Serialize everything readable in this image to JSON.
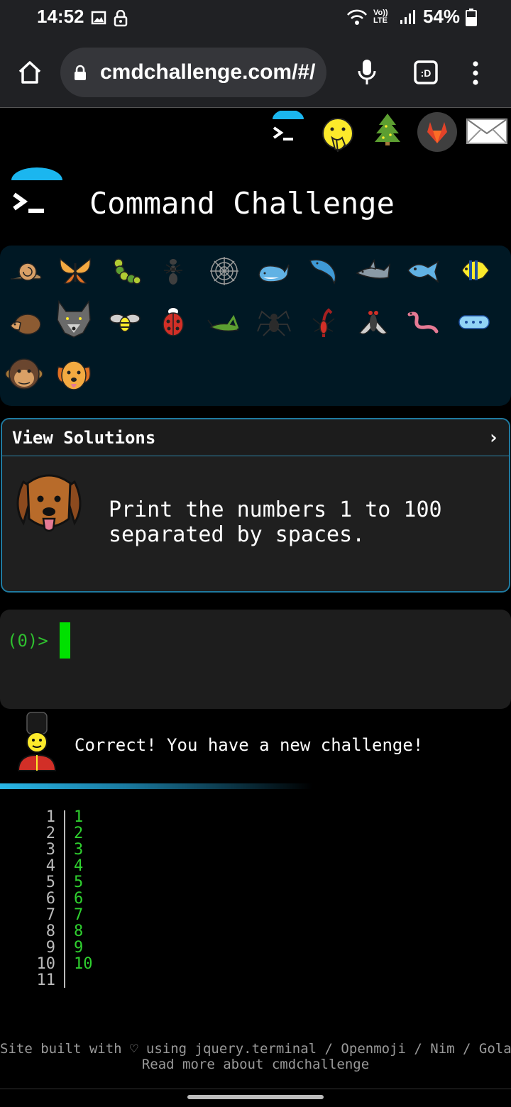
{
  "status_bar": {
    "time": "14:52",
    "battery_pct": "54%",
    "network": "Vo)) LTE",
    "icons": [
      "gallery-icon",
      "lock-icon",
      "wifi-icon",
      "signal-icon",
      "battery-icon"
    ]
  },
  "browser": {
    "url": "cmdchallenge.com/#/",
    "icons": [
      "home-icon",
      "lock-icon",
      "mic-icon",
      "tab-switcher-icon",
      "kebab-menu-icon"
    ]
  },
  "top_icons": [
    "terminal-logo-icon",
    "shushing-face-icon",
    "tree-icon",
    "gitlab-icon",
    "mail-icon"
  ],
  "title": "Command Challenge",
  "challenges": [
    "snail",
    "butterfly",
    "caterpillar",
    "ant",
    "spiderweb",
    "whale",
    "dolphin",
    "shark",
    "fish",
    "tropical-fish",
    "hedgehog",
    "wolf",
    "bee",
    "ladybug",
    "cricket",
    "spider",
    "scorpion",
    "fly",
    "worm",
    "microbe",
    "monkey",
    "dog"
  ],
  "solutions": {
    "label": "View Solutions",
    "chevron": "›",
    "description": "Print the numbers 1 to 100 separated by spaces."
  },
  "terminal": {
    "prompt": "(0)>"
  },
  "message": "Correct! You have a new challenge!",
  "output": {
    "line_numbers": [
      "1",
      "2",
      "3",
      "4",
      "5",
      "6",
      "7",
      "8",
      "9",
      "10",
      "11"
    ],
    "lines": [
      "1",
      "2",
      "3",
      "4",
      "5",
      "6",
      "7",
      "8",
      "9",
      "10"
    ]
  },
  "footer": {
    "line1": "Site built with ♡ using jquery.terminal / Openmoji / Nim / Golang",
    "line2": "Read more about cmdchallenge"
  },
  "colors": {
    "accent": "#29b6e6",
    "prompt": "#2fbf2f",
    "grid_bg": "#001824"
  }
}
